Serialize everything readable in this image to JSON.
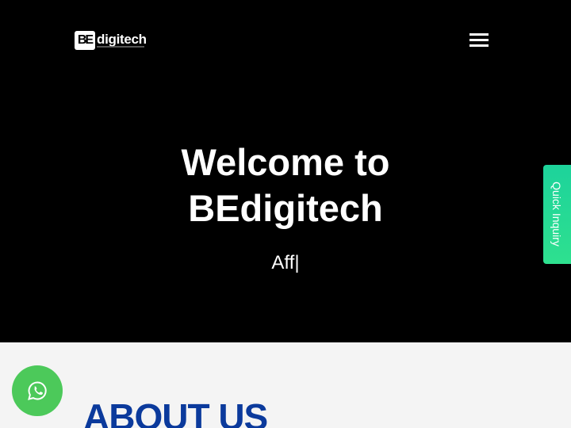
{
  "header": {
    "logo_mark": "BE",
    "logo_text": "digitech",
    "menu_icon": "hamburger-menu-icon"
  },
  "hero": {
    "title_line1": "Welcome to",
    "title_line2": "BEdigitech",
    "subtitle": "Aff|"
  },
  "quick_inquiry": {
    "label": "Quick Inquiry",
    "color": "#1dd39b"
  },
  "about": {
    "heading": "ABOUT US",
    "heading_color": "#0b3a9c"
  },
  "whatsapp": {
    "icon": "whatsapp-icon",
    "color": "#4cc95a"
  },
  "colors": {
    "hero_background": "#000000",
    "section_background": "#f4f4f4"
  }
}
